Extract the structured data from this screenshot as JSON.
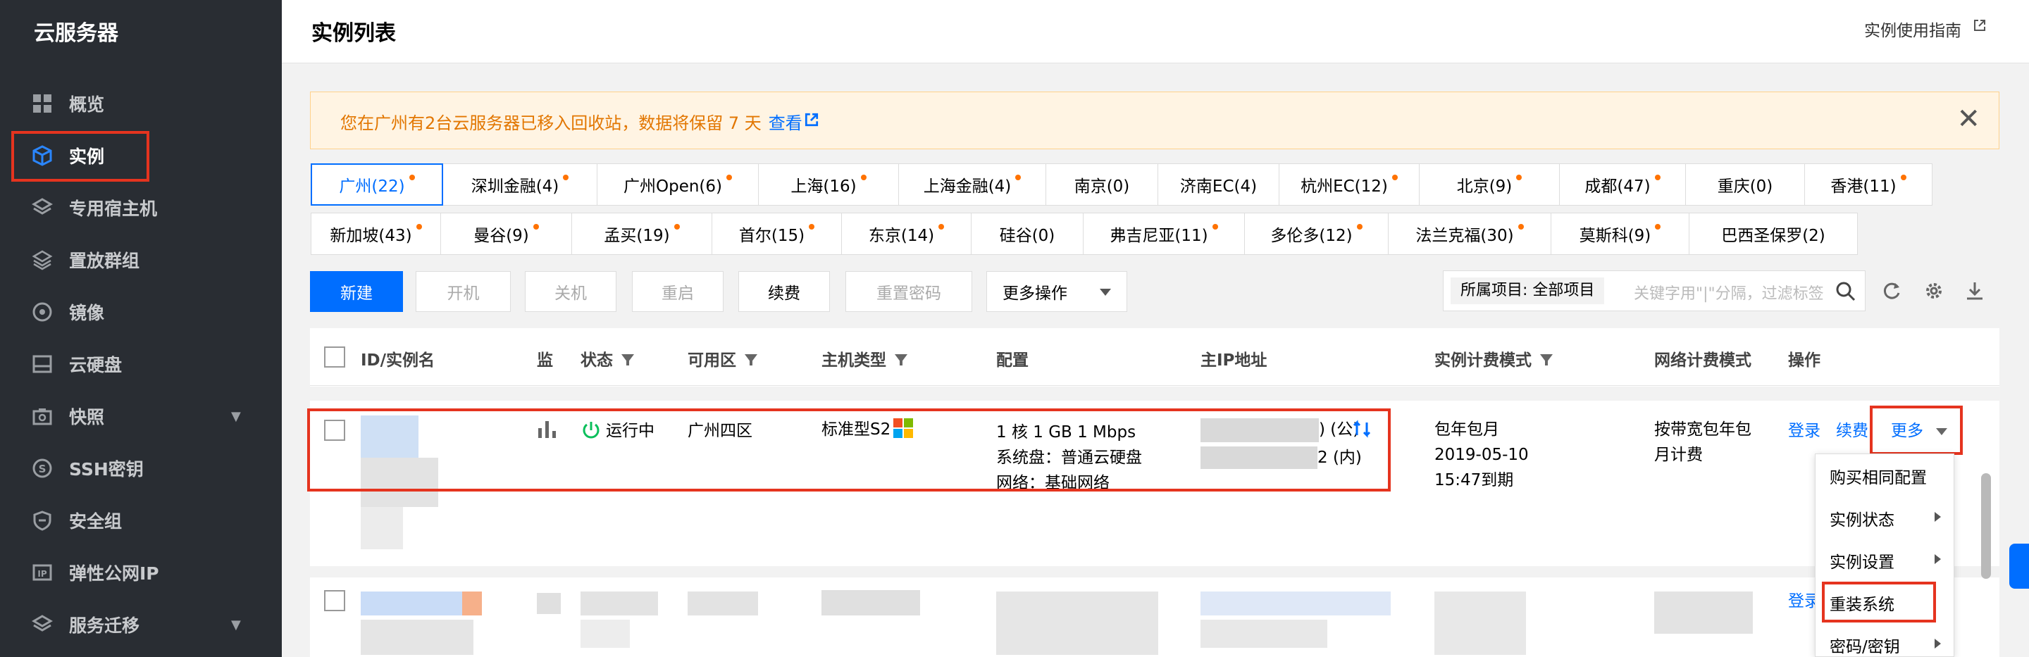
{
  "sidebar": {
    "title": "云服务器",
    "items": [
      {
        "label": "概览",
        "icon": "grid-icon"
      },
      {
        "label": "实例",
        "icon": "cube-icon"
      },
      {
        "label": "专用宿主机",
        "icon": "layers-icon"
      },
      {
        "label": "置放群组",
        "icon": "placement-icon"
      },
      {
        "label": "镜像",
        "icon": "disc-icon"
      },
      {
        "label": "云硬盘",
        "icon": "disk-icon"
      },
      {
        "label": "快照",
        "icon": "camera-icon"
      },
      {
        "label": "SSH密钥",
        "icon": "key-icon"
      },
      {
        "label": "安全组",
        "icon": "shield-icon"
      },
      {
        "label": "弹性公网IP",
        "icon": "ip-icon"
      },
      {
        "label": "服务迁移",
        "icon": "migrate-icon"
      }
    ]
  },
  "header": {
    "title": "实例列表",
    "guide": "实例使用指南"
  },
  "notice": {
    "text": "您在广州有2台云服务器已移入回收站，数据将保留 7 天",
    "link": "查看"
  },
  "regions": {
    "row1": [
      "广州(22)",
      "深圳金融(4)",
      "广州Open(6)",
      "上海(16)",
      "上海金融(4)",
      "南京(0)",
      "济南EC(4)",
      "杭州EC(12)",
      "北京(9)",
      "成都(47)",
      "重庆(0)",
      "香港(11)"
    ],
    "row2": [
      "新加坡(43)",
      "曼谷(9)",
      "孟买(19)",
      "首尔(15)",
      "东京(14)",
      "硅谷(0)",
      "弗吉尼亚(11)",
      "多伦多(12)",
      "法兰克福(30)",
      "莫斯科(9)",
      "巴西圣保罗(2)"
    ]
  },
  "toolbar": {
    "new": "新建",
    "start": "开机",
    "stop": "关机",
    "restart": "重启",
    "renew": "续费",
    "reset_pwd": "重置密码",
    "more": "更多操作",
    "project_tag": "所属项目: 全部项目",
    "search_placeholder": "关键字用\"|\"分隔，过滤标签"
  },
  "table": {
    "headers": {
      "id": "ID/实例名",
      "monitor": "监",
      "status": "状态",
      "zone": "可用区",
      "type": "主机类型",
      "config": "配置",
      "ip": "主IP地址",
      "billing": "实例计费模式",
      "net_billing": "网络计费模式",
      "ops": "操作"
    },
    "row1": {
      "status": "运行中",
      "zone": "广州四区",
      "type": "标准型S2",
      "config1": "1 核 1 GB 1 Mbps",
      "config2": "系统盘：普通云硬盘",
      "config3": "网络：基础网络",
      "ip_pub_suffix": ") (公)",
      "ip_int_suffix": "2 (内)",
      "billing1": "包年包月",
      "billing2": "2019-05-10",
      "billing3": "15:47到期",
      "net_billing1": "按带宽包年包",
      "net_billing2": "月计费",
      "login": "登录",
      "renew": "续费",
      "more": "更多"
    },
    "row2": {
      "login": "登录"
    }
  },
  "dropdown": {
    "items": [
      "购买相同配置",
      "实例状态",
      "实例设置",
      "重装系统",
      "密码/密钥"
    ]
  },
  "colors": {
    "accent": "#006eff",
    "highlight": "#e5341f",
    "running": "#0abf5b",
    "notice": "#e27600"
  }
}
